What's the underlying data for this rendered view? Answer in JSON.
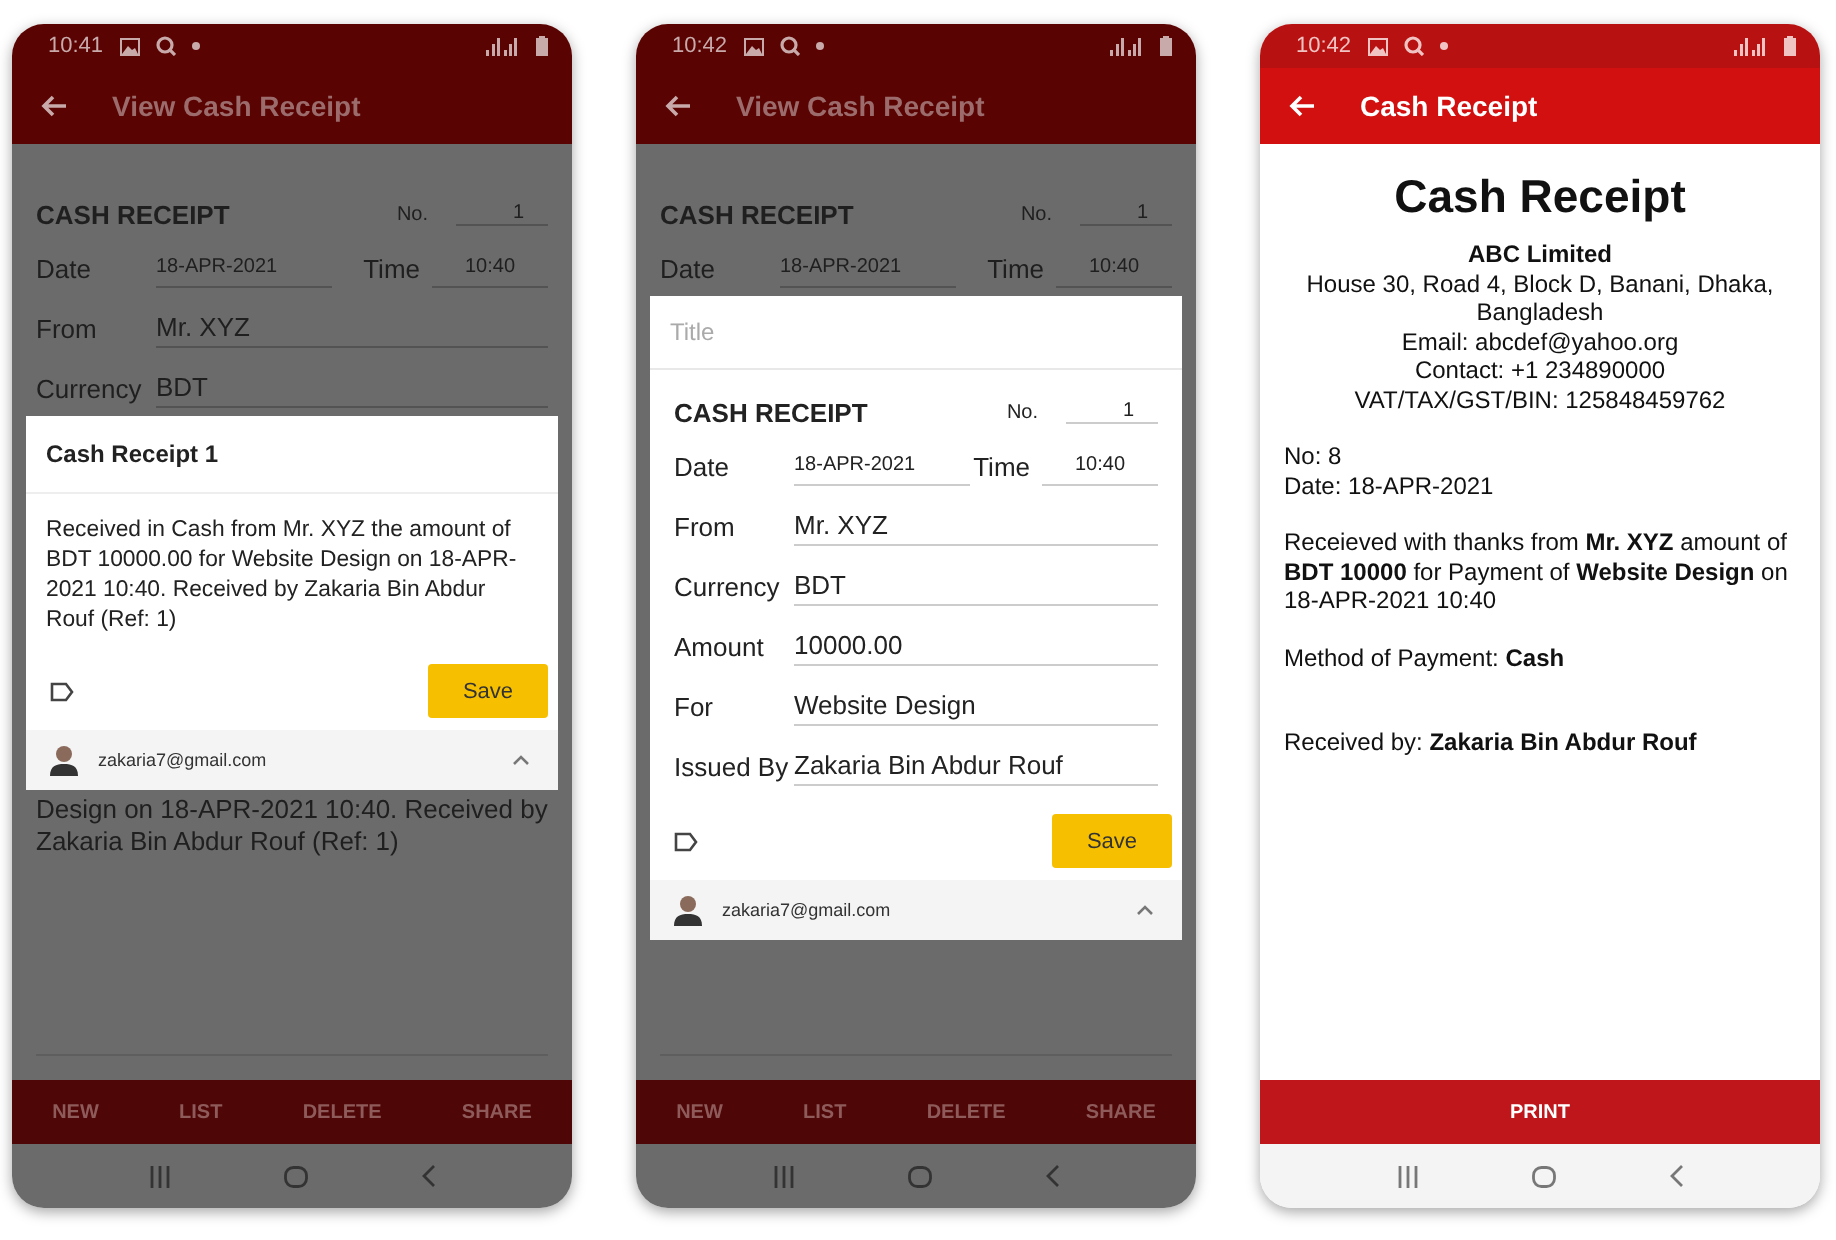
{
  "phones": [
    {
      "kind": "share_dialog",
      "status_time": "10:41",
      "title": "View Cash Receipt",
      "form": {
        "heading": "CASH RECEIPT",
        "no_label": "No.",
        "no_value": "1",
        "date_label": "Date",
        "date": "18-APR-2021",
        "time_label": "Time",
        "time": "10:40",
        "fields": [
          {
            "label": "From",
            "value": "Mr. XYZ"
          },
          {
            "label": "Currency",
            "value": "BDT"
          }
        ]
      },
      "dialog": {
        "title": "Cash Receipt 1",
        "body": "Received in Cash from Mr. XYZ the amount of BDT 10000.00 for Website Design on 18-APR-2021 10:40. Received by Zakaria Bin Abdur Rouf (Ref: 1)",
        "save": "Save",
        "account": "zakaria7@gmail.com"
      },
      "trailing_text": "Design on 18-APR-2021 10:40. Received by Zakaria Bin Abdur Rouf (Ref: 1)",
      "actions": [
        "NEW",
        "LIST",
        "DELETE",
        "SHARE"
      ]
    },
    {
      "kind": "form_dialog",
      "status_time": "10:42",
      "title": "View Cash Receipt",
      "form": {
        "heading": "CASH RECEIPT",
        "no_label": "No.",
        "no_value": "1",
        "date_label": "Date",
        "date": "18-APR-2021",
        "time_label": "Time",
        "time": "10:40"
      },
      "dialog": {
        "placeholder": "Title",
        "form": {
          "heading": "CASH RECEIPT",
          "no_label": "No.",
          "no_value": "1",
          "date_label": "Date",
          "date": "18-APR-2021",
          "time_label": "Time",
          "time": "10:40",
          "fields": [
            {
              "label": "From",
              "value": "Mr. XYZ"
            },
            {
              "label": "Currency",
              "value": "BDT"
            },
            {
              "label": "Amount",
              "value": "10000.00"
            },
            {
              "label": "For",
              "value": "Website Design"
            },
            {
              "label": "Issued By",
              "value": "Zakaria Bin Abdur Rouf"
            }
          ]
        },
        "save": "Save",
        "account": "zakaria7@gmail.com"
      },
      "actions": [
        "NEW",
        "LIST",
        "DELETE",
        "SHARE"
      ]
    },
    {
      "kind": "receipt",
      "status_time": "10:42",
      "title": "Cash Receipt",
      "receipt": {
        "heading": "Cash Receipt",
        "company": "ABC Limited",
        "company_lines": [
          "House 30, Road 4, Block D, Banani, Dhaka, Bangladesh",
          "Email: abcdef@yahoo.org",
          "Contact: +1 234890000",
          "VAT/TAX/GST/BIN: 125848459762"
        ],
        "no": "No: 8",
        "date": "Date: 18-APR-2021",
        "statement": "Receieved with thanks from **Mr. XYZ** amount of **BDT 10000** for Payment of **Website Design** on 18-APR-2021 10:40",
        "method": "Method of Payment: **Cash**",
        "received_by": "Received by: **Zakaria Bin Abdur Rouf**"
      },
      "print": "PRINT"
    }
  ]
}
